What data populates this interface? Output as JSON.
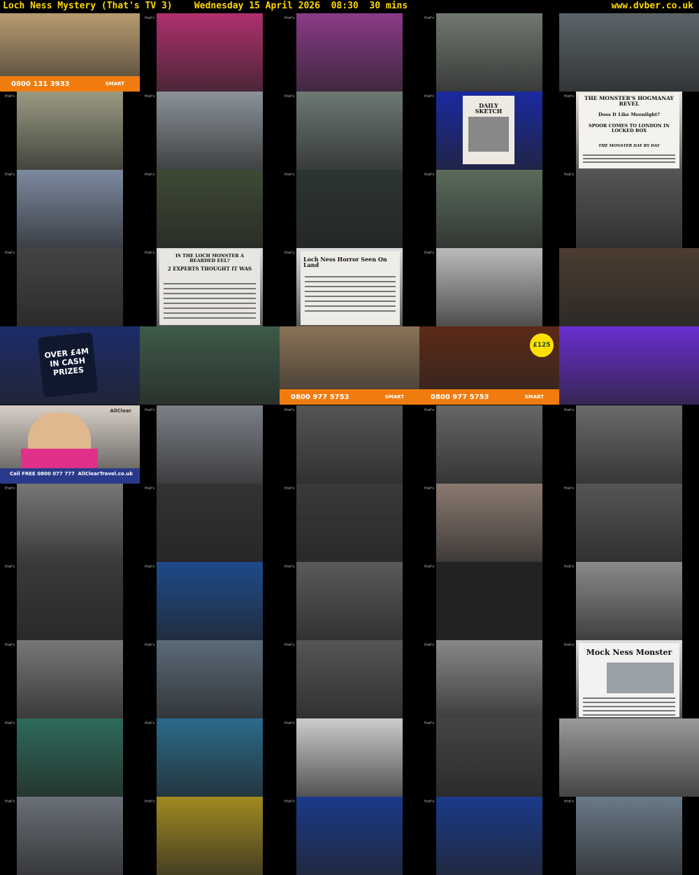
{
  "header": {
    "title": "Loch Ness Mystery (That's TV 3)    Wednesday 15 April 2026  08:30  30 mins",
    "site": "www.dvber.co.uk"
  },
  "channel_logo": "that's",
  "ads": {
    "phone_1": "0800 131 3933",
    "phone_2": "0800 977 5753",
    "smart_brand": "SMART",
    "prize_text": "OVER £4M IN CASH PRIZES",
    "bigger_text": "£125",
    "allclear_phone": "Call FREE 0800 077 777",
    "allclear_site": "AllClearTravel.co.uk",
    "allclear_brand": "AllClear"
  },
  "newspapers": {
    "daily_sketch": "DAILY SKETCH",
    "hogmanay": "THE MONSTER'S HOGMANAY REVEL",
    "hogmanay_sub": "Does It Like Moonlight?",
    "hogmanay_sub2": "SPOOR COMES TO LONDON IN LOCKED BOX",
    "hogmanay_foot": "THE MONSTER DAY BY DAY",
    "bearded_eel": "IS THE LOCH MONSTER A BEARDED EEL?",
    "bearded_sub": "2 EXPERTS THOUGHT IT WAS",
    "horror": "Loch Ness Horror Seen On Land",
    "mock": "Mock Ness Monster"
  },
  "thumbs": [
    {
      "bg": "#b89c70",
      "ad": "p1"
    },
    {
      "bg": "#b0306e"
    },
    {
      "bg": "#8a3a88"
    },
    {
      "bg": "#707870"
    },
    {
      "bg": "#5a6468"
    },
    {
      "bg": "#9a9a82"
    },
    {
      "bg": "#8a9298"
    },
    {
      "bg": "#6d7a74"
    },
    {
      "bg": "#1a2aa0",
      "np": "daily"
    },
    {
      "bg": "#e8e4dc",
      "np": "hog"
    },
    {
      "bg": "#7c8aa0"
    },
    {
      "bg": "#3e4a34"
    },
    {
      "bg": "#2c3434"
    },
    {
      "bg": "#5a6c5c"
    },
    {
      "bg": "#555"
    },
    {
      "bg": "#444"
    },
    {
      "bg": "#ddd",
      "np": "eel"
    },
    {
      "bg": "#ddd",
      "np": "horror"
    },
    {
      "bg": "#bbb"
    },
    {
      "bg": "#4a3c30"
    },
    {
      "bg": "#1c2c6a",
      "ad": "prize"
    },
    {
      "bg": "#3e5a48"
    },
    {
      "bg": "#8a7256",
      "ad": "p2"
    },
    {
      "bg": "#5c2a18",
      "ad": "p2b"
    },
    {
      "bg": "#6a2ed0"
    },
    {
      "bg": "#d8d0c8",
      "ad": "allclear"
    },
    {
      "bg": "#7c8088"
    },
    {
      "bg": "#555"
    },
    {
      "bg": "#666"
    },
    {
      "bg": "#6a6a6a"
    },
    {
      "bg": "#777"
    },
    {
      "bg": "#333"
    },
    {
      "bg": "#3a3a3a"
    },
    {
      "bg": "#8a7a70"
    },
    {
      "bg": "#555"
    },
    {
      "bg": "#3a3a3a"
    },
    {
      "bg": "#1e4a8a"
    },
    {
      "bg": "#5a5a5a"
    },
    {
      "bg": "#222"
    },
    {
      "bg": "#8a8a8a"
    },
    {
      "bg": "#777"
    },
    {
      "bg": "#5a6a78"
    },
    {
      "bg": "#555"
    },
    {
      "bg": "#888"
    },
    {
      "bg": "#ddd",
      "np": "mock"
    },
    {
      "bg": "#2e6a5a"
    },
    {
      "bg": "#2a6a8a"
    },
    {
      "bg": "#ccc"
    },
    {
      "bg": "#444"
    },
    {
      "bg": "#9a9a9a"
    },
    {
      "bg": "#6a7078"
    },
    {
      "bg": "#a08a20"
    },
    {
      "bg": "#1a3a8a"
    },
    {
      "bg": "#1a3a8a"
    },
    {
      "bg": "#6a7a88"
    }
  ]
}
